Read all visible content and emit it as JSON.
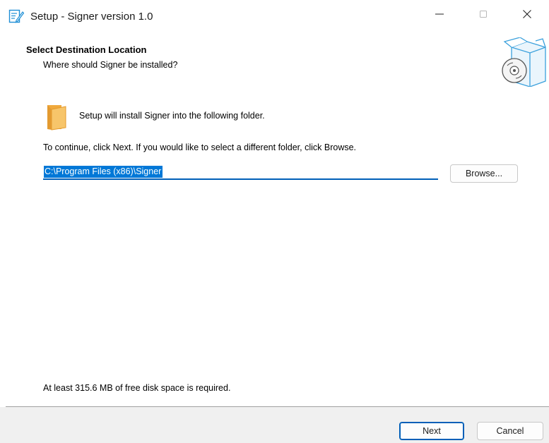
{
  "window": {
    "title": "Setup - Signer version 1.0",
    "icons": {
      "app": "installer-edit-icon",
      "minimize": "minimize-icon",
      "maximize": "maximize-icon",
      "close": "close-icon"
    }
  },
  "header": {
    "title": "Select Destination Location",
    "subtitle": "Where should Signer be installed?",
    "icon": "install-box-disc-icon"
  },
  "body": {
    "folder_icon": "folder-icon",
    "info_text": "Setup will install Signer into the following folder.",
    "continue_text": "To continue, click Next. If you would like to select a different folder, click Browse.",
    "path_value": "C:\\Program Files (x86)\\Signer",
    "browse_label": "Browse...",
    "disk_space_text": "At least 315.6 MB of free disk space is required."
  },
  "footer": {
    "next_label": "Next",
    "cancel_label": "Cancel"
  },
  "colors": {
    "accent": "#005fb8",
    "selection": "#0078d7",
    "folder": "#f5b94a",
    "box_outline": "#3aa0dc",
    "footer_bg": "#f0f0f0"
  }
}
